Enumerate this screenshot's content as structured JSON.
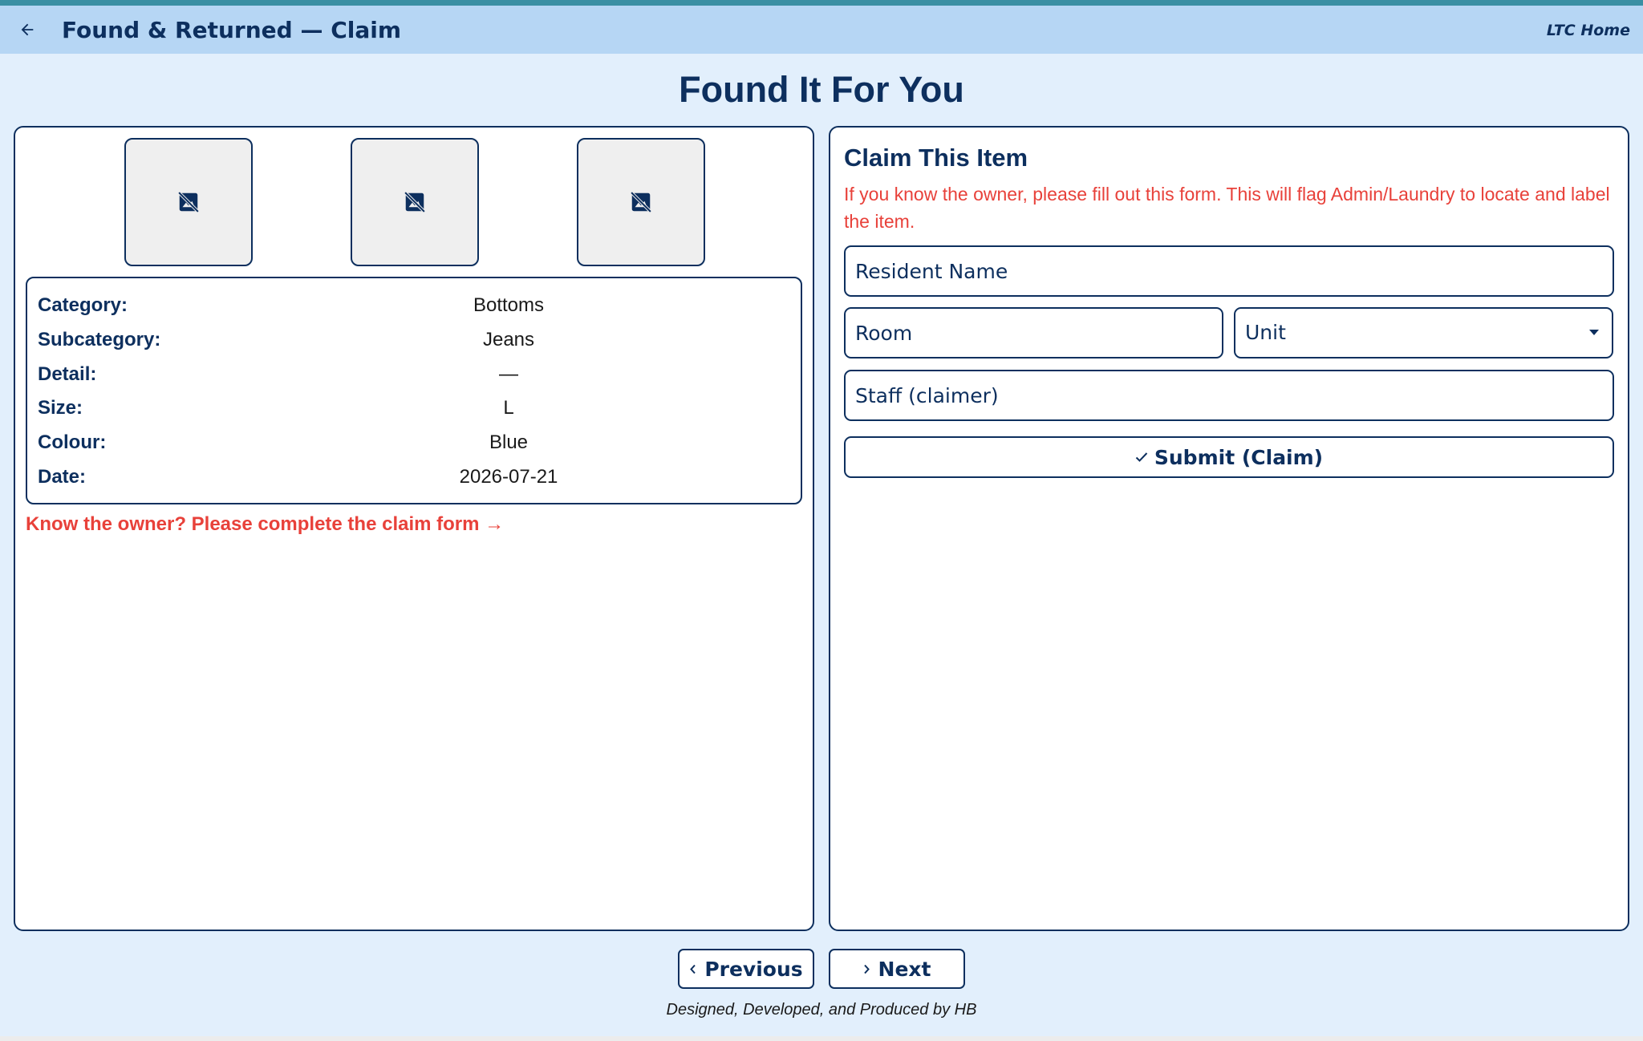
{
  "appbar": {
    "title": "Found & Returned — Claim",
    "home_label": "LTC Home",
    "back_icon": "arrow-left-icon"
  },
  "page": {
    "title": "Found It For You"
  },
  "photos": [
    {
      "icon": "image-not-supported-icon"
    },
    {
      "icon": "image-not-supported-icon"
    },
    {
      "icon": "image-not-supported-icon"
    }
  ],
  "details": [
    {
      "label": "Category:",
      "value": "Bottoms"
    },
    {
      "label": "Subcategory:",
      "value": "Jeans"
    },
    {
      "label": "Detail:",
      "value": "—"
    },
    {
      "label": "Size:",
      "value": "L"
    },
    {
      "label": "Colour:",
      "value": "Blue"
    },
    {
      "label": "Date:",
      "value": "2026-07-21"
    }
  ],
  "owner_prompt": "Know the owner? Please complete the claim form →",
  "claim": {
    "heading": "Claim This Item",
    "info": "If you know the owner, please fill out this form. This will flag Admin/Laundry to locate and label the item.",
    "resident_placeholder": "Resident Name",
    "room_placeholder": "Room",
    "unit_label": "Unit",
    "staff_placeholder": "Staff (claimer)",
    "submit_label": "Submit (Claim)"
  },
  "nav": {
    "previous_label": "Previous",
    "next_label": "Next"
  },
  "footer": "Designed, Developed, and Produced by HB",
  "colors": {
    "primary": "#0d2f5e",
    "accent_red": "#e8413a",
    "appbar_bg": "#b6d6f4",
    "page_bg": "#e2effc"
  }
}
